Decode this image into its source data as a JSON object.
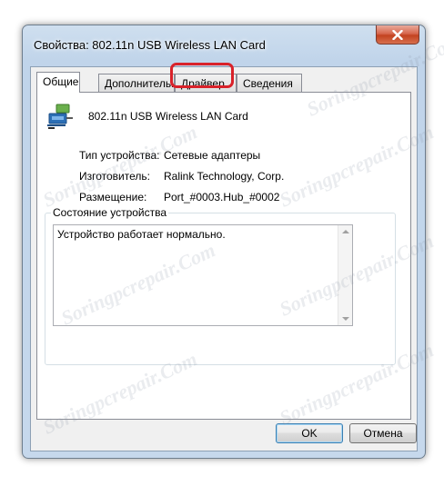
{
  "window": {
    "title": "Свойства: 802.11n USB Wireless LAN Card"
  },
  "tabs": [
    {
      "label": "Общие",
      "active": true
    },
    {
      "label": "Дополнительно",
      "active": false
    },
    {
      "label": "Драйвер",
      "active": false,
      "highlighted": true
    },
    {
      "label": "Сведения",
      "active": false
    }
  ],
  "device": {
    "icon": "network-adapter-icon",
    "name": "802.11n USB Wireless LAN Card",
    "type_label": "Тип устройства:",
    "type_value": "Сетевые адаптеры",
    "manufacturer_label": "Изготовитель:",
    "manufacturer_value": "Ralink Technology, Corp.",
    "location_label": "Размещение:",
    "location_value": "Port_#0003.Hub_#0002"
  },
  "status": {
    "group_title": "Состояние устройства",
    "text": "Устройство работает нормально."
  },
  "buttons": {
    "ok": "OK",
    "cancel": "Отмена"
  },
  "watermark": "Soringpcrepair.Com",
  "colors": {
    "highlight": "#d9222a",
    "close_button": "#c3421f",
    "default_button_border": "#3c7fb1"
  }
}
